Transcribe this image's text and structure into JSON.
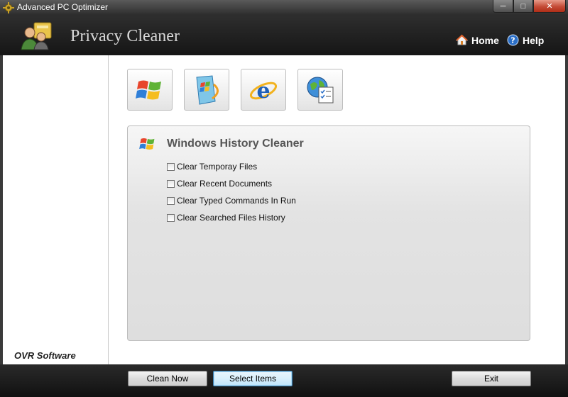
{
  "window": {
    "title": "Advanced PC Optimizer",
    "controls": [
      "─",
      "□",
      "✕"
    ]
  },
  "header": {
    "title": "Privacy Cleaner",
    "home_label": "Home",
    "help_label": "Help"
  },
  "toolbar": {
    "tools": [
      {
        "name": "windows-logo-icon"
      },
      {
        "name": "windows-media-icon"
      },
      {
        "name": "internet-explorer-icon"
      },
      {
        "name": "globe-document-icon"
      }
    ]
  },
  "panel": {
    "title": "Windows History Cleaner",
    "options": [
      {
        "label": "Clear Temporay Files",
        "checked": false
      },
      {
        "label": "Clear Recent Documents",
        "checked": false
      },
      {
        "label": "Clear Typed Commands In Run",
        "checked": false
      },
      {
        "label": "Clear Searched Files History",
        "checked": false
      }
    ]
  },
  "sidebar": {
    "company": "OVR Software"
  },
  "footer": {
    "clean_label": "Clean Now",
    "select_label": "Select Items",
    "exit_label": "Exit"
  },
  "colors": {
    "header_bg": "#1e1e1e",
    "accent_blue": "#2b6fc7",
    "close_red": "#c44b36"
  }
}
